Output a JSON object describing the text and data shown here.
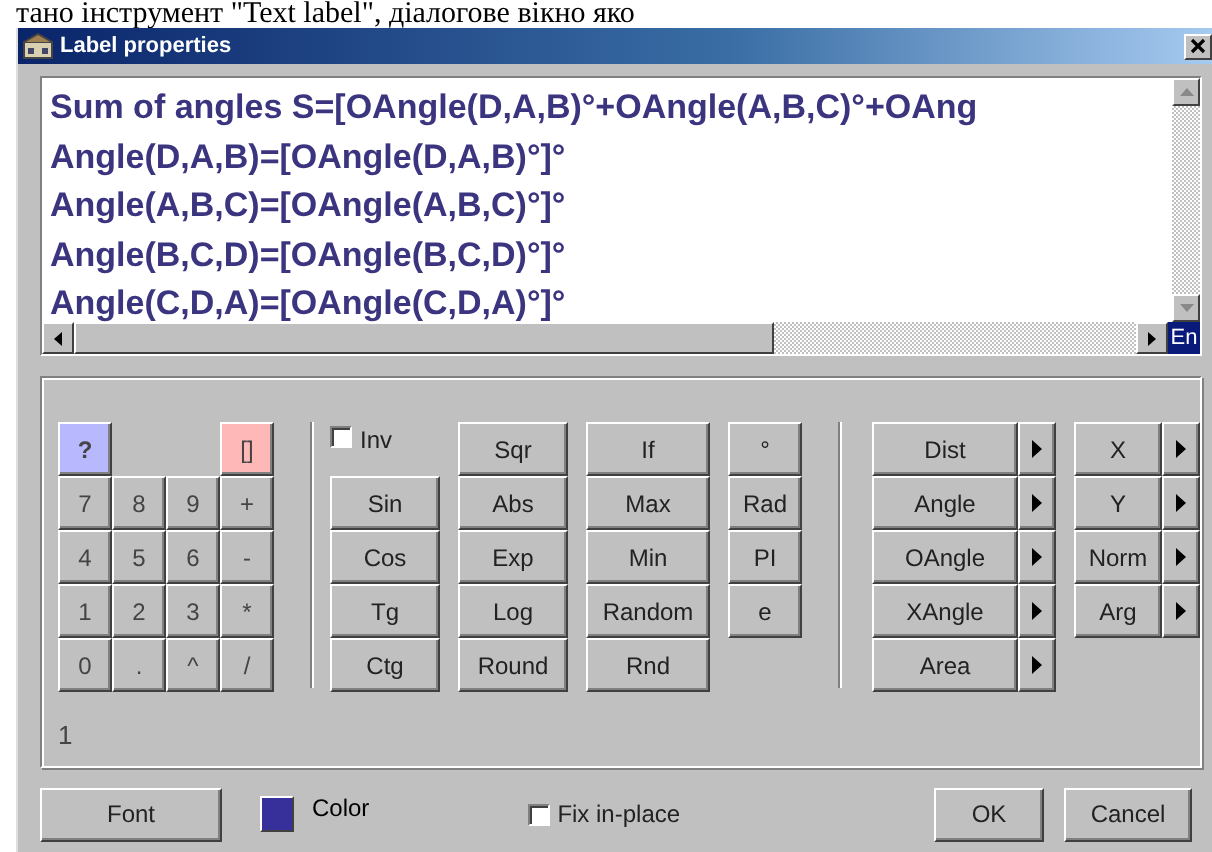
{
  "document_text": "тано інструмент \"Text label\", діалогове вікно яко",
  "window": {
    "title": "Label properties"
  },
  "editor": {
    "lines": [
      "Sum of angles S=[OAngle(D,A,B)°+OAngle(A,B,C)°+OAng",
      "Angle(D,A,B)=[OAngle(D,A,B)°]°",
      "Angle(A,B,C)=[OAngle(A,B,C)°]°",
      "Angle(B,C,D)=[OAngle(B,C,D)°]°",
      "Angle(C,D,A)=[OAngle(C,D,A)°]°"
    ],
    "input_language": "En"
  },
  "keypad": {
    "top": [
      {
        "label": "?",
        "kind": "help"
      },
      {
        "label": "[]",
        "kind": "brackets"
      }
    ],
    "keys": [
      "7",
      "8",
      "9",
      "+",
      "4",
      "5",
      "6",
      "-",
      "1",
      "2",
      "3",
      "*",
      "0",
      ".",
      "^",
      "/"
    ]
  },
  "functions": [
    [
      {
        "kind": "checkbox",
        "label": "Inv",
        "checked": false
      },
      {
        "kind": "button",
        "label": "Sin"
      },
      {
        "kind": "button",
        "label": "Cos"
      },
      {
        "kind": "button",
        "label": "Tg"
      },
      {
        "kind": "button",
        "label": "Ctg"
      }
    ],
    [
      {
        "kind": "button",
        "label": "Sqr"
      },
      {
        "kind": "button",
        "label": "Abs"
      },
      {
        "kind": "button",
        "label": "Exp"
      },
      {
        "kind": "button",
        "label": "Log"
      },
      {
        "kind": "button",
        "label": "Round"
      }
    ],
    [
      {
        "kind": "button",
        "label": "If"
      },
      {
        "kind": "button",
        "label": "Max"
      },
      {
        "kind": "button",
        "label": "Min"
      },
      {
        "kind": "button",
        "label": "Random"
      },
      {
        "kind": "button",
        "label": "Rnd"
      }
    ],
    [
      {
        "kind": "button",
        "label": "°"
      },
      {
        "kind": "button",
        "label": "Rad"
      },
      {
        "kind": "button",
        "label": "PI"
      },
      {
        "kind": "button",
        "label": "e"
      }
    ]
  ],
  "menus": [
    [
      "Dist",
      "Angle",
      "OAngle",
      "XAngle",
      "Area"
    ],
    [
      "X",
      "Y",
      "Norm",
      "Arg"
    ]
  ],
  "result": "1",
  "footer": {
    "font_button": "Font",
    "color": {
      "label": "Color",
      "color": "#38309a"
    },
    "fix_in_place": {
      "label": "Fix in-place",
      "checked": false
    },
    "buttons": [
      "OK",
      "Cancel"
    ]
  }
}
